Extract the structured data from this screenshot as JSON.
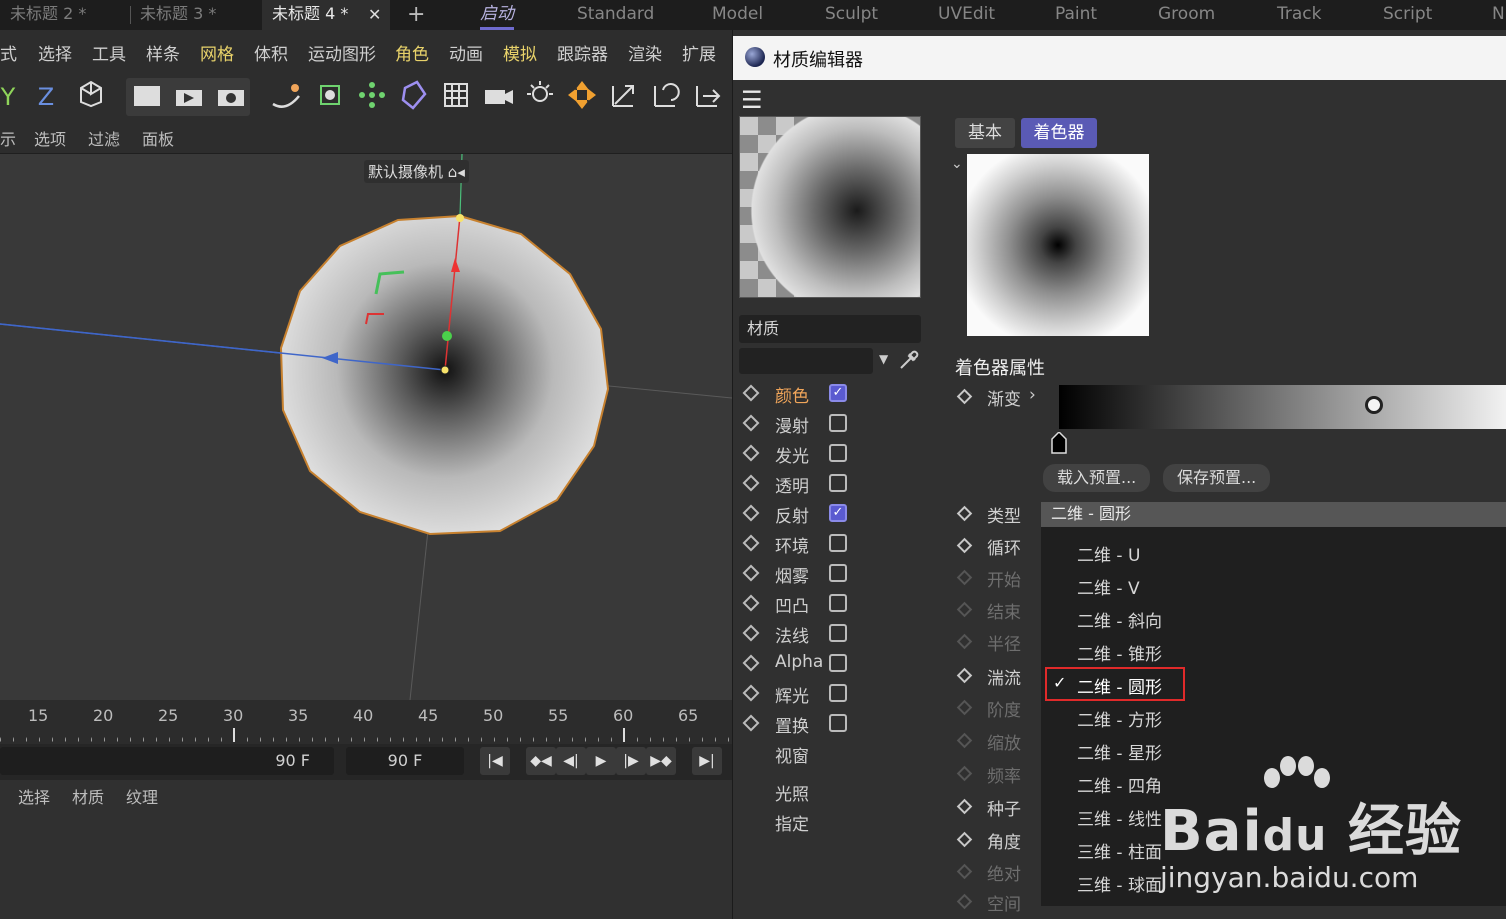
{
  "top_tabs": [
    "未标题 2 *",
    "未标题 3 *",
    "未标题 4 *"
  ],
  "active_tab_close": "✕",
  "add_tab": "+",
  "layouts": [
    "启动",
    "Standard",
    "Model",
    "Sculpt",
    "UVEdit",
    "Paint",
    "Groom",
    "Track",
    "Script",
    "N"
  ],
  "main_menu": [
    "式",
    "选择",
    "工具",
    "样条",
    "网格",
    "体积",
    "运动图形",
    "角色",
    "动画",
    "模拟",
    "跟踪器",
    "渲染",
    "扩展"
  ],
  "view_menu": [
    "示",
    "选项",
    "过滤",
    "面板"
  ],
  "toolbar_axes": [
    "Y",
    "Z"
  ],
  "camera_label": "默认摄像机",
  "timeline_ticks": [
    "15",
    "20",
    "25",
    "30",
    "35",
    "40",
    "45",
    "50",
    "55",
    "60",
    "65"
  ],
  "frame_end_left": "90 F",
  "frame_end_right": "90 F",
  "material_manager_menu": [
    "选择",
    "材质",
    "纹理"
  ],
  "editor": {
    "title": "材质编辑器",
    "material_name": "材质",
    "channels": [
      {
        "label": "颜色",
        "checked": true
      },
      {
        "label": "漫射",
        "checked": false
      },
      {
        "label": "发光",
        "checked": false
      },
      {
        "label": "透明",
        "checked": false
      },
      {
        "label": "反射",
        "checked": true
      },
      {
        "label": "环境",
        "checked": false
      },
      {
        "label": "烟雾",
        "checked": false
      },
      {
        "label": "凹凸",
        "checked": false
      },
      {
        "label": "法线",
        "checked": false
      },
      {
        "label": "Alpha",
        "checked": false
      },
      {
        "label": "辉光",
        "checked": false
      },
      {
        "label": "置换",
        "checked": false
      }
    ],
    "extra_channels": [
      "视窗",
      "光照",
      "指定"
    ],
    "tab_basic": "基本",
    "tab_shader": "着色器",
    "shader_props_title": "着色器属性",
    "gradient_label": "渐变",
    "load_preset": "载入预置...",
    "save_preset": "保存预置...",
    "props": [
      {
        "label": "类型",
        "enabled": true
      },
      {
        "label": "循环",
        "enabled": true
      },
      {
        "label": "开始",
        "enabled": false
      },
      {
        "label": "结束",
        "enabled": false
      },
      {
        "label": "半径",
        "enabled": false
      },
      {
        "label": "湍流",
        "enabled": true
      },
      {
        "label": "阶度",
        "enabled": false
      },
      {
        "label": "缩放",
        "enabled": false
      },
      {
        "label": "频率",
        "enabled": false
      },
      {
        "label": "种子",
        "enabled": true
      },
      {
        "label": "角度",
        "enabled": true
      },
      {
        "label": "绝对",
        "enabled": false
      },
      {
        "label": "空间",
        "enabled": false
      }
    ],
    "type_value": "二维 - 圆形",
    "type_options": [
      "二维 - U",
      "二维 - V",
      "二维 - 斜向",
      "二维 - 锥形",
      "二维 - 圆形",
      "二维 - 方形",
      "二维 - 星形",
      "二维 - 四角",
      "三维 - 线性",
      "三维 - 柱面",
      "三维 - 球面"
    ],
    "selected_option_index": 4
  },
  "watermark": {
    "brand": "Bai",
    "brand_cn": "经验",
    "url": "jingyan.baidu.com"
  },
  "colors": {
    "accent": "#5a5ab5",
    "highlight_menu": "#e8d26a",
    "orange_label": "#f0a55a",
    "red_box": "#e02a2a"
  }
}
